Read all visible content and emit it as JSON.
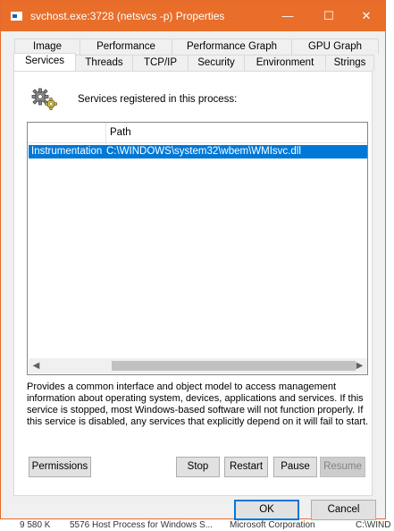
{
  "window": {
    "title": "svchost.exe:3728 (netsvcs -p) Properties",
    "controls": {
      "minimize": "—",
      "maximize": "☐",
      "close": "✕"
    }
  },
  "tabs": {
    "row1": [
      "Image",
      "Performance",
      "Performance Graph",
      "GPU Graph"
    ],
    "row2": [
      "Services",
      "Threads",
      "TCP/IP",
      "Security",
      "Environment",
      "Strings"
    ],
    "active": "Services"
  },
  "services": {
    "header": "Services registered in this process:",
    "columns": [
      "",
      "Path"
    ],
    "rows": [
      {
        "name": "Instrumentation",
        "path": "C:\\WINDOWS\\system32\\wbem\\WMIsvc.dll",
        "selected": true
      }
    ],
    "description": "Provides a common interface and object model to access management information about operating system, devices, applications and services. If this service is stopped, most Windows-based software will not function properly. If this service is disabled, any services that explicitly depend on it will fail to start."
  },
  "buttons": {
    "permissions": "Permissions",
    "stop": "Stop",
    "restart": "Restart",
    "pause": "Pause",
    "resume": "Resume",
    "ok": "OK",
    "cancel": "Cancel"
  },
  "background_app": {
    "bottom_row": [
      "9 580 K",
      "5576 Host Process for Windows S...",
      "Microsoft Corporation",
      "C:\\WIND"
    ]
  },
  "colors": {
    "titlebar": "#e86e2a",
    "selection": "#0078d7",
    "accent_border": "#0078d7"
  }
}
